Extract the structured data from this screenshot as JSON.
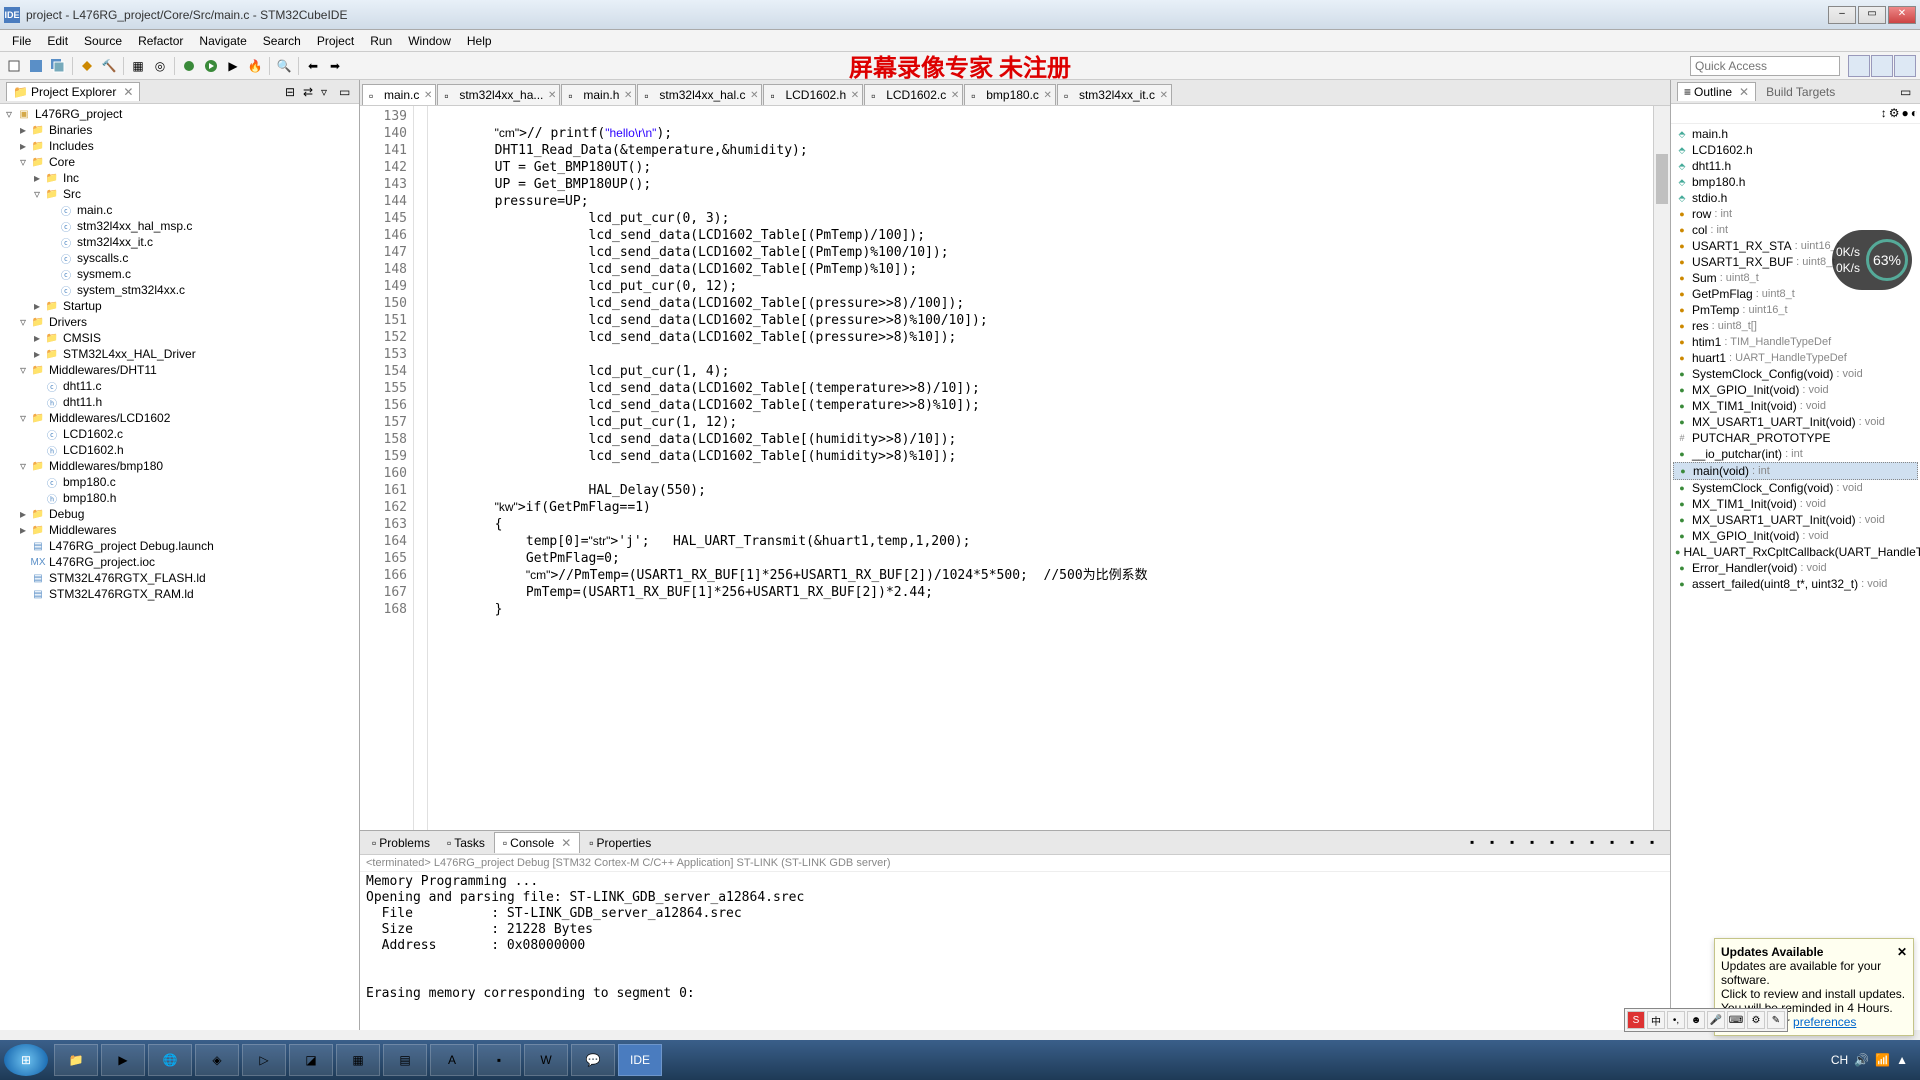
{
  "window": {
    "title": "project - L476RG_project/Core/Src/main.c - STM32CubeIDE"
  },
  "menu": [
    "File",
    "Edit",
    "Source",
    "Refactor",
    "Navigate",
    "Search",
    "Project",
    "Run",
    "Window",
    "Help"
  ],
  "watermark": "屏幕录像专家 未注册",
  "quickaccess": "Quick Access",
  "projectExplorer": {
    "title": "Project Explorer",
    "tree": [
      {
        "d": 0,
        "t": "exp",
        "icon": "proj",
        "label": "L476RG_project"
      },
      {
        "d": 1,
        "t": "col",
        "icon": "fold",
        "label": "Binaries"
      },
      {
        "d": 1,
        "t": "col",
        "icon": "fold",
        "label": "Includes"
      },
      {
        "d": 1,
        "t": "exp",
        "icon": "fold",
        "label": "Core"
      },
      {
        "d": 2,
        "t": "col",
        "icon": "fold",
        "label": "Inc"
      },
      {
        "d": 2,
        "t": "exp",
        "icon": "fold",
        "label": "Src"
      },
      {
        "d": 3,
        "t": "leaf",
        "icon": "c",
        "label": "main.c"
      },
      {
        "d": 3,
        "t": "leaf",
        "icon": "c",
        "label": "stm32l4xx_hal_msp.c"
      },
      {
        "d": 3,
        "t": "leaf",
        "icon": "c",
        "label": "stm32l4xx_it.c"
      },
      {
        "d": 3,
        "t": "leaf",
        "icon": "c",
        "label": "syscalls.c"
      },
      {
        "d": 3,
        "t": "leaf",
        "icon": "c",
        "label": "sysmem.c"
      },
      {
        "d": 3,
        "t": "leaf",
        "icon": "c",
        "label": "system_stm32l4xx.c"
      },
      {
        "d": 2,
        "t": "col",
        "icon": "fold",
        "label": "Startup"
      },
      {
        "d": 1,
        "t": "exp",
        "icon": "fold",
        "label": "Drivers"
      },
      {
        "d": 2,
        "t": "col",
        "icon": "fold",
        "label": "CMSIS"
      },
      {
        "d": 2,
        "t": "col",
        "icon": "fold",
        "label": "STM32L4xx_HAL_Driver"
      },
      {
        "d": 1,
        "t": "exp",
        "icon": "fold",
        "label": "Middlewares/DHT11"
      },
      {
        "d": 2,
        "t": "leaf",
        "icon": "c",
        "label": "dht11.c"
      },
      {
        "d": 2,
        "t": "leaf",
        "icon": "h",
        "label": "dht11.h"
      },
      {
        "d": 1,
        "t": "exp",
        "icon": "fold",
        "label": "Middlewares/LCD1602"
      },
      {
        "d": 2,
        "t": "leaf",
        "icon": "c",
        "label": "LCD1602.c"
      },
      {
        "d": 2,
        "t": "leaf",
        "icon": "h",
        "label": "LCD1602.h"
      },
      {
        "d": 1,
        "t": "exp",
        "icon": "fold",
        "label": "Middlewares/bmp180"
      },
      {
        "d": 2,
        "t": "leaf",
        "icon": "c",
        "label": "bmp180.c"
      },
      {
        "d": 2,
        "t": "leaf",
        "icon": "h",
        "label": "bmp180.h"
      },
      {
        "d": 1,
        "t": "col",
        "icon": "fold",
        "label": "Debug"
      },
      {
        "d": 1,
        "t": "col",
        "icon": "fold",
        "label": "Middlewares"
      },
      {
        "d": 1,
        "t": "leaf",
        "icon": "file",
        "label": "L476RG_project Debug.launch"
      },
      {
        "d": 1,
        "t": "leaf",
        "icon": "mx",
        "label": "L476RG_project.ioc"
      },
      {
        "d": 1,
        "t": "leaf",
        "icon": "file",
        "label": "STM32L476RGTX_FLASH.ld"
      },
      {
        "d": 1,
        "t": "leaf",
        "icon": "file",
        "label": "STM32L476RGTX_RAM.ld"
      }
    ]
  },
  "editorTabs": [
    {
      "label": "main.c",
      "active": true
    },
    {
      "label": "stm32l4xx_ha..."
    },
    {
      "label": "main.h"
    },
    {
      "label": "stm32l4xx_hal.c"
    },
    {
      "label": "LCD1602.h"
    },
    {
      "label": "LCD1602.c"
    },
    {
      "label": "bmp180.c"
    },
    {
      "label": "stm32l4xx_it.c"
    }
  ],
  "code": {
    "start": 139,
    "lines": [
      "",
      "        // printf(\"hello\\r\\n\");",
      "        DHT11_Read_Data(&temperature,&humidity);",
      "        UT = Get_BMP180UT();",
      "        UP = Get_BMP180UP();",
      "        pressure=UP;",
      "                    lcd_put_cur(0, 3);",
      "                    lcd_send_data(LCD1602_Table[(PmTemp)/100]);",
      "                    lcd_send_data(LCD1602_Table[(PmTemp)%100/10]);",
      "                    lcd_send_data(LCD1602_Table[(PmTemp)%10]);",
      "                    lcd_put_cur(0, 12);",
      "                    lcd_send_data(LCD1602_Table[(pressure>>8)/100]);",
      "                    lcd_send_data(LCD1602_Table[(pressure>>8)%100/10]);",
      "                    lcd_send_data(LCD1602_Table[(pressure>>8)%10]);",
      "",
      "                    lcd_put_cur(1, 4);",
      "                    lcd_send_data(LCD1602_Table[(temperature>>8)/10]);",
      "                    lcd_send_data(LCD1602_Table[(temperature>>8)%10]);",
      "                    lcd_put_cur(1, 12);",
      "                    lcd_send_data(LCD1602_Table[(humidity>>8)/10]);",
      "                    lcd_send_data(LCD1602_Table[(humidity>>8)%10]);",
      "",
      "                    HAL_Delay(550);",
      "        if(GetPmFlag==1)",
      "        {",
      "            temp[0]='j';   HAL_UART_Transmit(&huart1,temp,1,200);",
      "            GetPmFlag=0;",
      "            //PmTemp=(USART1_RX_BUF[1]*256+USART1_RX_BUF[2])/1024*5*500;  //500为比例系数",
      "            PmTemp=(USART1_RX_BUF[1]*256+USART1_RX_BUF[2])*2.44;",
      "        }"
    ]
  },
  "outline": {
    "title": "Outline",
    "buildTargets": "Build Targets",
    "items": [
      {
        "icon": "inc",
        "label": "main.h",
        "type": ""
      },
      {
        "icon": "inc",
        "label": "LCD1602.h",
        "type": ""
      },
      {
        "icon": "inc",
        "label": "dht11.h",
        "type": ""
      },
      {
        "icon": "inc",
        "label": "bmp180.h",
        "type": ""
      },
      {
        "icon": "inc",
        "label": "stdio.h",
        "type": ""
      },
      {
        "icon": "var",
        "label": "row",
        "type": ": int"
      },
      {
        "icon": "var",
        "label": "col",
        "type": ": int"
      },
      {
        "icon": "var",
        "label": "USART1_RX_STA",
        "type": ": uint16_t"
      },
      {
        "icon": "var",
        "label": "USART1_RX_BUF",
        "type": ": uint8_t"
      },
      {
        "icon": "var",
        "label": "Sum",
        "type": ": uint8_t"
      },
      {
        "icon": "var",
        "label": "GetPmFlag",
        "type": ": uint8_t"
      },
      {
        "icon": "var",
        "label": "PmTemp",
        "type": ": uint16_t"
      },
      {
        "icon": "var",
        "label": "res",
        "type": ": uint8_t[]"
      },
      {
        "icon": "var",
        "label": "htim1",
        "type": ": TIM_HandleTypeDef"
      },
      {
        "icon": "var",
        "label": "huart1",
        "type": ": UART_HandleTypeDef"
      },
      {
        "icon": "fn",
        "label": "SystemClock_Config(void)",
        "type": ": void"
      },
      {
        "icon": "fn",
        "label": "MX_GPIO_Init(void)",
        "type": ": void"
      },
      {
        "icon": "fn",
        "label": "MX_TIM1_Init(void)",
        "type": ": void"
      },
      {
        "icon": "fn",
        "label": "MX_USART1_UART_Init(void)",
        "type": ": void"
      },
      {
        "icon": "def",
        "label": "PUTCHAR_PROTOTYPE",
        "type": ""
      },
      {
        "icon": "fn",
        "label": "__io_putchar(int)",
        "type": ": int"
      },
      {
        "icon": "fn",
        "label": "main(void)",
        "type": ": int",
        "sel": true
      },
      {
        "icon": "fn",
        "label": "SystemClock_Config(void)",
        "type": ": void"
      },
      {
        "icon": "fn",
        "label": "MX_TIM1_Init(void)",
        "type": ": void"
      },
      {
        "icon": "fn",
        "label": "MX_USART1_UART_Init(void)",
        "type": ": void"
      },
      {
        "icon": "fn",
        "label": "MX_GPIO_Init(void)",
        "type": ": void"
      },
      {
        "icon": "fn",
        "label": "HAL_UART_RxCpltCallback(UART_HandleTypeDef*)",
        "type": ""
      },
      {
        "icon": "fn",
        "label": "Error_Handler(void)",
        "type": ": void"
      },
      {
        "icon": "fn",
        "label": "assert_failed(uint8_t*, uint32_t)",
        "type": ": void"
      }
    ]
  },
  "bottomTabs": [
    {
      "label": "Problems"
    },
    {
      "label": "Tasks"
    },
    {
      "label": "Console",
      "active": true
    },
    {
      "label": "Properties"
    }
  ],
  "console": {
    "sub": "<terminated> L476RG_project Debug [STM32 Cortex-M C/C++ Application] ST-LINK (ST-LINK GDB server)",
    "lines": [
      "Memory Programming ...",
      "Opening and parsing file: ST-LINK_GDB_server_a12864.srec",
      "  File          : ST-LINK_GDB_server_a12864.srec",
      "  Size          : 21228 Bytes",
      "  Address       : 0x08000000",
      "",
      "",
      "Erasing memory corresponding to segment 0:"
    ]
  },
  "updates": {
    "title": "Updates Available",
    "msg1": "Updates are available for your software.",
    "msg2": "Click to review and install updates.",
    "msg3": "You will be reminded in 4 Hours.",
    "msg4": "Set reminder",
    "link": "preferences"
  },
  "gauge": {
    "pct": "63%",
    "l1": "0K/s",
    "l2": "0K/s"
  },
  "tray_items": [
    "CH",
    "▲"
  ]
}
